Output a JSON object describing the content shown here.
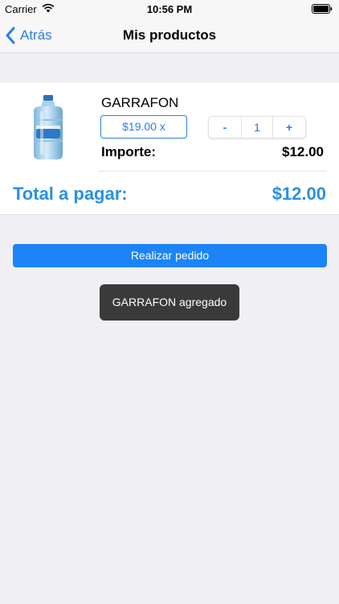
{
  "status_bar": {
    "carrier": "Carrier",
    "time": "10:56 PM",
    "wifi_icon": "wifi-icon",
    "battery_icon": "battery-icon"
  },
  "nav": {
    "back_label": "Atrás",
    "back_icon": "chevron-left-icon",
    "title": "Mis productos"
  },
  "cart": {
    "items": [
      {
        "name": "GARRAFON",
        "price_label": "$19.00 x",
        "stepper_minus": "-",
        "quantity": "1",
        "stepper_plus": "+",
        "subtotal_label": "Importe:",
        "subtotal_value": "$12.00"
      }
    ],
    "total_label": "Total a pagar:",
    "total_value": "$12.00"
  },
  "actions": {
    "order_button": "Realizar pedido"
  },
  "toast": {
    "message": "GARRAFON agregado"
  },
  "colors": {
    "accent": "#2b7de9",
    "total_text": "#2b90e0",
    "primary_button": "#1c84f7",
    "toast_bg": "#3a3a3a",
    "background": "#efeff4"
  }
}
